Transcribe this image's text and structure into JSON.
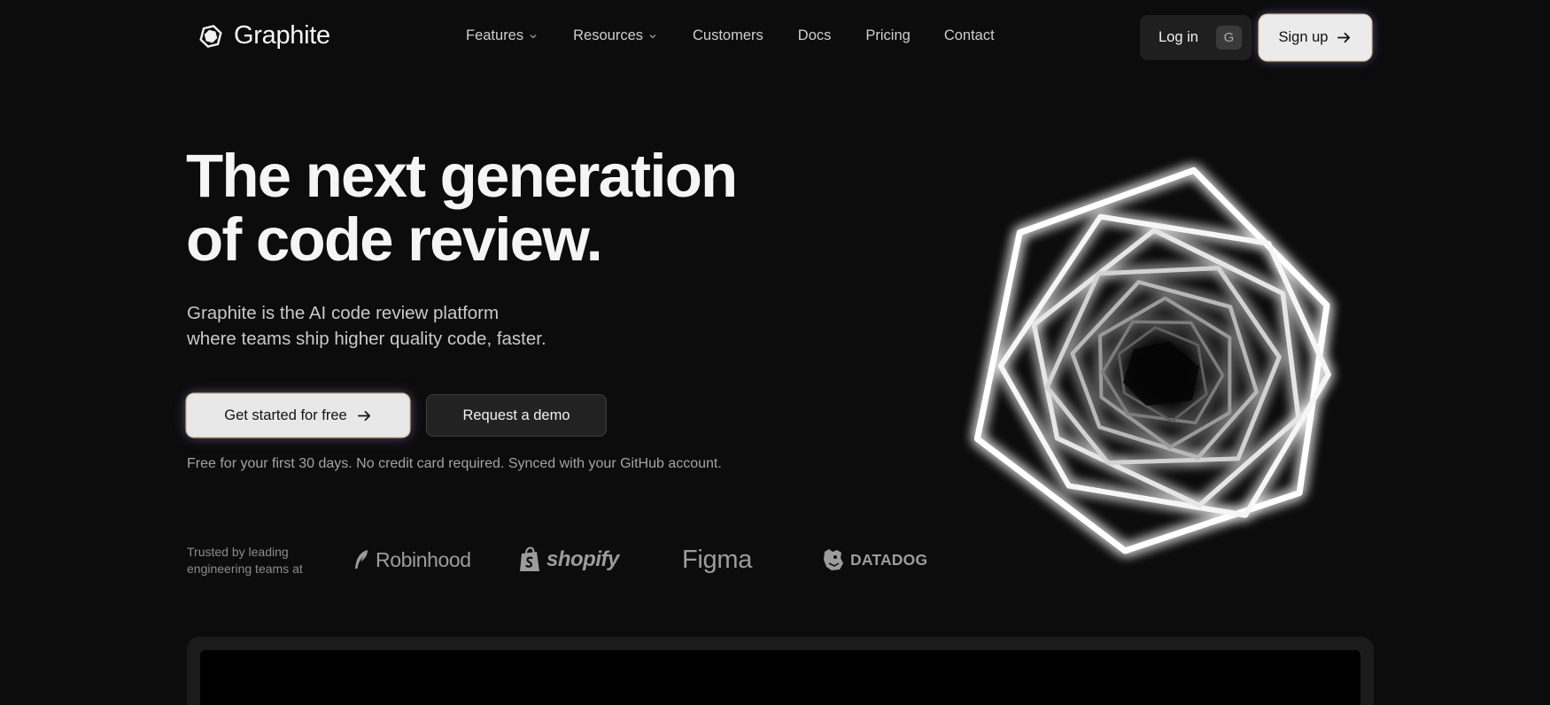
{
  "nav": {
    "brand": "Graphite",
    "links": [
      {
        "label": "Features",
        "dropdown": true
      },
      {
        "label": "Resources",
        "dropdown": true
      },
      {
        "label": "Customers",
        "dropdown": false
      },
      {
        "label": "Docs",
        "dropdown": false
      },
      {
        "label": "Pricing",
        "dropdown": false
      },
      {
        "label": "Contact",
        "dropdown": false
      }
    ],
    "login": {
      "label": "Log in",
      "shortcut": "G"
    },
    "signup": {
      "label": "Sign up"
    }
  },
  "hero": {
    "title_line1": "The next generation",
    "title_line2": "of code review.",
    "subtitle_line1": "Graphite is the AI code review platform",
    "subtitle_line2": "where teams ship higher quality code, faster.",
    "cta_primary": "Get started for free",
    "cta_secondary": "Request a demo",
    "fineprint": "Free for your first 30 days. No credit card required. Synced with your GitHub account."
  },
  "trusted": {
    "line1": "Trusted by leading",
    "line2": "engineering teams at",
    "brands": [
      "Robinhood",
      "shopify",
      "Figma",
      "DATADOG"
    ]
  },
  "colors": {
    "background": "#0c0c0c",
    "primary_button": "#e8e8e8",
    "secondary_button": "#222222",
    "glow_outline": "#e2c79b"
  },
  "icons": [
    "graphite-logo-icon",
    "chevron-down-icon",
    "arrow-right-icon",
    "robinhood-feather-icon",
    "shopify-bag-icon",
    "datadog-dog-icon",
    "hexagon-spiral-art"
  ]
}
